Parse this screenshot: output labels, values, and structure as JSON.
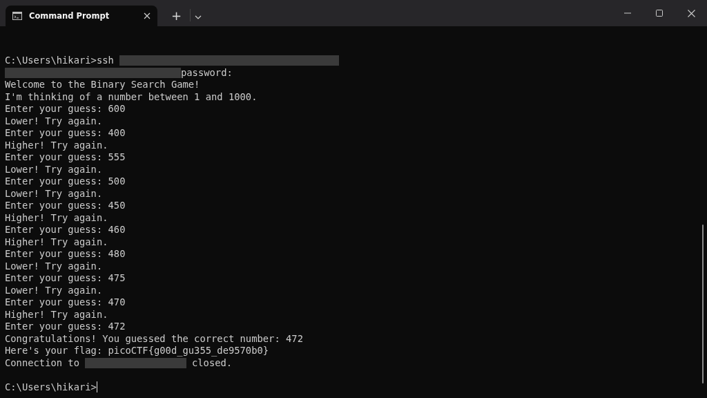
{
  "window": {
    "tab": {
      "title": "Command Prompt",
      "selected": true
    },
    "new_tab": "+"
  },
  "terminal": {
    "lines": [
      {
        "segments": [
          {
            "kind": "text",
            "text": "C:\\Users\\hikari>ssh"
          },
          {
            "kind": "redacted"
          }
        ]
      },
      {
        "segments": [
          {
            "kind": "redacted"
          },
          {
            "kind": "text",
            "text": "password:"
          }
        ]
      },
      {
        "segments": [
          {
            "kind": "text",
            "text": "Welcome to the Binary Search Game!"
          }
        ]
      },
      {
        "segments": [
          {
            "kind": "text",
            "text": "I'm thinking of a number between 1 and 1000."
          }
        ]
      },
      {
        "segments": [
          {
            "kind": "text",
            "text": "Enter your guess: 600"
          }
        ]
      },
      {
        "segments": [
          {
            "kind": "text",
            "text": "Lower! Try again."
          }
        ]
      },
      {
        "segments": [
          {
            "kind": "text",
            "text": "Enter your guess: 400"
          }
        ]
      },
      {
        "segments": [
          {
            "kind": "text",
            "text": "Higher! Try again."
          }
        ]
      },
      {
        "segments": [
          {
            "kind": "text",
            "text": "Enter your guess: 555"
          }
        ]
      },
      {
        "segments": [
          {
            "kind": "text",
            "text": "Lower! Try again."
          }
        ]
      },
      {
        "segments": [
          {
            "kind": "text",
            "text": "Enter your guess: 500"
          }
        ]
      },
      {
        "segments": [
          {
            "kind": "text",
            "text": "Lower! Try again."
          }
        ]
      },
      {
        "segments": [
          {
            "kind": "text",
            "text": "Enter your guess: 450"
          }
        ]
      },
      {
        "segments": [
          {
            "kind": "text",
            "text": "Higher! Try again."
          }
        ]
      },
      {
        "segments": [
          {
            "kind": "text",
            "text": "Enter your guess: 460"
          }
        ]
      },
      {
        "segments": [
          {
            "kind": "text",
            "text": "Higher! Try again."
          }
        ]
      },
      {
        "segments": [
          {
            "kind": "text",
            "text": "Enter your guess: 480"
          }
        ]
      },
      {
        "segments": [
          {
            "kind": "text",
            "text": "Lower! Try again."
          }
        ]
      },
      {
        "segments": [
          {
            "kind": "text",
            "text": "Enter your guess: 475"
          }
        ]
      },
      {
        "segments": [
          {
            "kind": "text",
            "text": "Lower! Try again."
          }
        ]
      },
      {
        "segments": [
          {
            "kind": "text",
            "text": "Enter your guess: 470"
          }
        ]
      },
      {
        "segments": [
          {
            "kind": "text",
            "text": "Higher! Try again."
          }
        ]
      },
      {
        "segments": [
          {
            "kind": "text",
            "text": "Enter your guess: 472"
          }
        ]
      },
      {
        "segments": [
          {
            "kind": "text",
            "text": "Congratulations! You guessed the correct number: 472"
          }
        ]
      },
      {
        "segments": [
          {
            "kind": "text",
            "text": "Here's your flag: picoCTF{g00d_gu355_de9570b0}"
          }
        ]
      },
      {
        "segments": [
          {
            "kind": "text",
            "text": "Connection to"
          },
          {
            "kind": "redacted"
          },
          {
            "kind": "text",
            "text": "closed."
          }
        ]
      },
      {
        "blank_before": true,
        "cursor": true,
        "segments": [
          {
            "kind": "text",
            "text": "C:\\Users\\hikari>"
          }
        ]
      }
    ]
  }
}
